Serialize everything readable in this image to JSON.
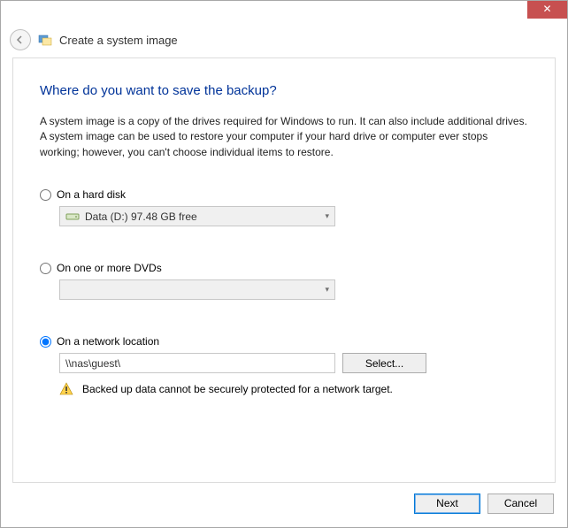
{
  "window": {
    "close_glyph": "✕"
  },
  "header": {
    "title": "Create a system image"
  },
  "main": {
    "heading": "Where do you want to save the backup?",
    "description": "A system image is a copy of the drives required for Windows to run. It can also include additional drives. A system image can be used to restore your computer if your hard drive or computer ever stops working; however, you can't choose individual items to restore."
  },
  "options": {
    "hard_disk": {
      "label": "On a hard disk",
      "selected_drive": "Data (D:)  97.48 GB free",
      "checked": false
    },
    "dvds": {
      "label": "On one or more DVDs",
      "selected": "",
      "checked": false
    },
    "network": {
      "label": "On a network location",
      "path": "\\\\nas\\guest\\",
      "select_button": "Select...",
      "warning": "Backed up data cannot be securely protected for a network target.",
      "checked": true
    }
  },
  "footer": {
    "next": "Next",
    "cancel": "Cancel"
  }
}
